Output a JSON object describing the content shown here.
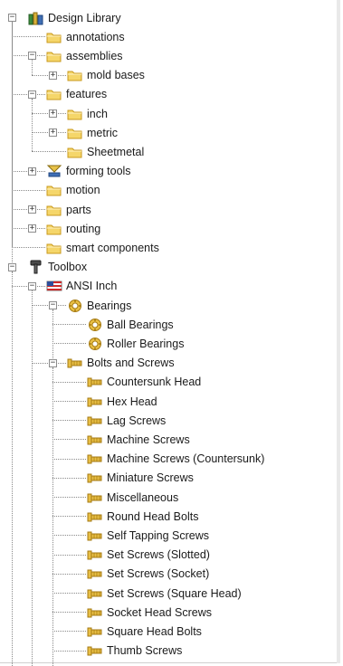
{
  "tree": {
    "items": [
      {
        "label": "Design Library",
        "icon": "design-library-icon",
        "level": 0,
        "expander": "minus"
      },
      {
        "label": "annotations",
        "icon": "folder-icon",
        "level": 1,
        "expander": "none"
      },
      {
        "label": "assemblies",
        "icon": "folder-icon",
        "level": 1,
        "expander": "minus"
      },
      {
        "label": "mold bases",
        "icon": "folder-icon",
        "level": 2,
        "expander": "plus"
      },
      {
        "label": "features",
        "icon": "folder-icon",
        "level": 1,
        "expander": "minus"
      },
      {
        "label": "inch",
        "icon": "folder-icon",
        "level": 2,
        "expander": "plus"
      },
      {
        "label": "metric",
        "icon": "folder-icon",
        "level": 2,
        "expander": "plus"
      },
      {
        "label": "Sheetmetal",
        "icon": "folder-icon",
        "level": 2,
        "expander": "none"
      },
      {
        "label": "forming tools",
        "icon": "forming-tools-icon",
        "level": 1,
        "expander": "plus"
      },
      {
        "label": "motion",
        "icon": "folder-icon",
        "level": 1,
        "expander": "none"
      },
      {
        "label": "parts",
        "icon": "folder-icon",
        "level": 1,
        "expander": "plus"
      },
      {
        "label": "routing",
        "icon": "folder-icon",
        "level": 1,
        "expander": "plus"
      },
      {
        "label": "smart components",
        "icon": "folder-icon",
        "level": 1,
        "expander": "none"
      },
      {
        "label": "Toolbox",
        "icon": "toolbox-icon",
        "level": 0,
        "expander": "minus"
      },
      {
        "label": "ANSI Inch",
        "icon": "us-flag-icon",
        "level": 1,
        "expander": "minus"
      },
      {
        "label": "Bearings",
        "icon": "bearing-icon",
        "level": 2,
        "expander": "minus"
      },
      {
        "label": "Ball Bearings",
        "icon": "bearing-icon",
        "level": 3,
        "expander": "none"
      },
      {
        "label": "Roller Bearings",
        "icon": "bearing-icon",
        "level": 3,
        "expander": "none"
      },
      {
        "label": "Bolts and Screws",
        "icon": "bolt-icon",
        "level": 2,
        "expander": "minus"
      },
      {
        "label": "Countersunk Head",
        "icon": "bolt-icon",
        "level": 3,
        "expander": "none"
      },
      {
        "label": "Hex Head",
        "icon": "bolt-icon",
        "level": 3,
        "expander": "none"
      },
      {
        "label": "Lag Screws",
        "icon": "bolt-icon",
        "level": 3,
        "expander": "none"
      },
      {
        "label": "Machine Screws",
        "icon": "bolt-icon",
        "level": 3,
        "expander": "none"
      },
      {
        "label": "Machine Screws (Countersunk)",
        "icon": "bolt-icon",
        "level": 3,
        "expander": "none"
      },
      {
        "label": "Miniature Screws",
        "icon": "bolt-icon",
        "level": 3,
        "expander": "none"
      },
      {
        "label": "Miscellaneous",
        "icon": "bolt-icon",
        "level": 3,
        "expander": "none"
      },
      {
        "label": "Round Head Bolts",
        "icon": "bolt-icon",
        "level": 3,
        "expander": "none"
      },
      {
        "label": "Self Tapping Screws",
        "icon": "bolt-icon",
        "level": 3,
        "expander": "none"
      },
      {
        "label": "Set Screws (Slotted)",
        "icon": "bolt-icon",
        "level": 3,
        "expander": "none"
      },
      {
        "label": "Set Screws (Socket)",
        "icon": "bolt-icon",
        "level": 3,
        "expander": "none"
      },
      {
        "label": "Set Screws (Square Head)",
        "icon": "bolt-icon",
        "level": 3,
        "expander": "none"
      },
      {
        "label": "Socket Head Screws",
        "icon": "bolt-icon",
        "level": 3,
        "expander": "none"
      },
      {
        "label": "Square Head Bolts",
        "icon": "bolt-icon",
        "level": 3,
        "expander": "none"
      },
      {
        "label": "Thumb Screws",
        "icon": "bolt-icon",
        "level": 3,
        "expander": "none"
      }
    ]
  },
  "colors": {
    "folder_fill": "#f5d66a",
    "folder_edge": "#c99a1e",
    "bolt_fill": "#e8bf45",
    "bolt_edge": "#a57a12",
    "tree_line": "#8a8a8a"
  }
}
